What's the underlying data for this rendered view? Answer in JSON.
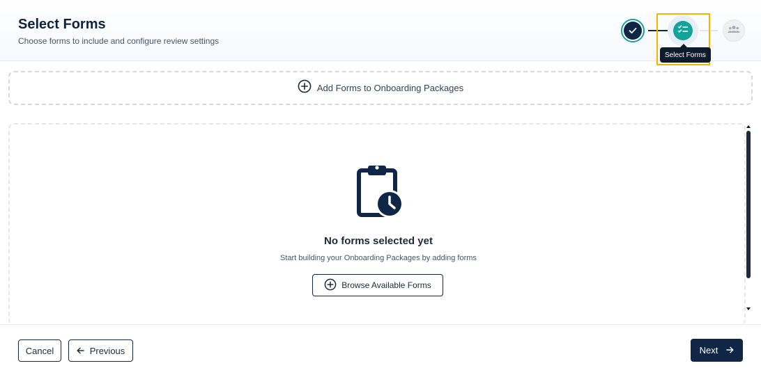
{
  "header": {
    "title": "Select Forms",
    "subtitle": "Choose forms to include and configure review settings"
  },
  "stepper": {
    "steps": [
      {
        "state": "completed",
        "icon": "check-icon"
      },
      {
        "state": "active",
        "icon": "checklist-icon",
        "tooltip": "Select Forms"
      },
      {
        "state": "upcoming",
        "icon": "users-icon"
      }
    ],
    "highlight_color": "#f5b400",
    "active_color": "#14a39a",
    "completed_color": "#0f2647"
  },
  "add_forms": {
    "label": "Add Forms to Onboarding Packages",
    "icon": "plus-circle-icon"
  },
  "empty_state": {
    "icon": "clipboard-clock-icon",
    "title": "No forms selected yet",
    "description": "Start building your Onboarding Packages by adding forms",
    "browse_label": "Browse Available Forms"
  },
  "footer": {
    "cancel_label": "Cancel",
    "previous_label": "Previous",
    "next_label": "Next"
  },
  "colors": {
    "primary": "#0f2647",
    "accent": "#14a39a"
  }
}
